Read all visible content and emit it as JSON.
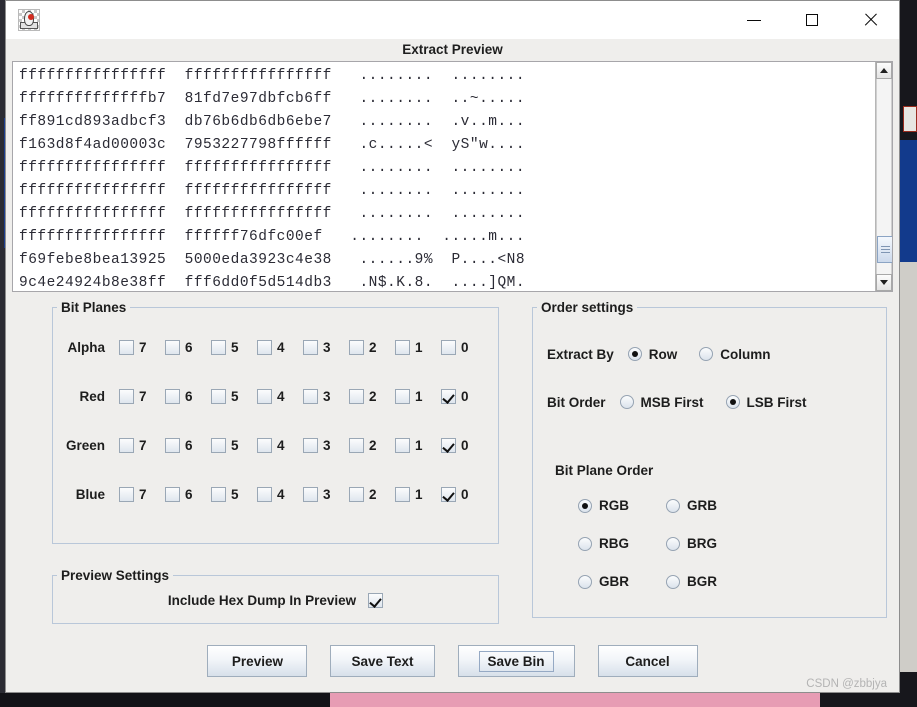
{
  "window": {
    "icon_name": "java-duke-icon",
    "title": "",
    "controls": {
      "minimize": "–",
      "maximize": "□",
      "close": "×"
    }
  },
  "dialog": {
    "heading": "Extract Preview"
  },
  "preview": {
    "hexdump": "ffffffffffffffff  ffffffffffffffff   ........  ........\nffffffffffffffb7  81fd7e97dbfcb6ff   ........  ..~.....\nff891cd893adbcf3  db76b6db6db6ebe7   ........  .v..m...\nf163d8f4ad00003c  7953227798ffffff   .c.....<  yS\"w....\nffffffffffffffff  ffffffffffffffff   ........  ........\nffffffffffffffff  ffffffffffffffff   ........  ........\nffffffffffffffff  ffffffffffffffff   ........  ........\nffffffffffffffff  ffffff76dfc00ef   ........  .....m...\nf69febe8bea13925  5000eda3923c4e38   ......9%  P....<N8\n9c4e24924b8e38ff  fff6dd0f5d514db3   .N$.K.8.  ....]QM.",
    "scrollbar": {
      "name": "vertical-scrollbar",
      "up_arrow": "▲",
      "down_arrow": "▼"
    }
  },
  "bit_planes": {
    "legend": "Bit Planes",
    "bits": [
      "7",
      "6",
      "5",
      "4",
      "3",
      "2",
      "1",
      "0"
    ],
    "rows": [
      {
        "label": "Alpha",
        "checked": [
          false,
          false,
          false,
          false,
          false,
          false,
          false,
          false
        ]
      },
      {
        "label": "Red",
        "checked": [
          false,
          false,
          false,
          false,
          false,
          false,
          false,
          true
        ]
      },
      {
        "label": "Green",
        "checked": [
          false,
          false,
          false,
          false,
          false,
          false,
          false,
          true
        ]
      },
      {
        "label": "Blue",
        "checked": [
          false,
          false,
          false,
          false,
          false,
          false,
          false,
          true
        ]
      }
    ]
  },
  "preview_settings": {
    "legend": "Preview Settings",
    "include_hex_dump_label": "Include Hex Dump In Preview",
    "include_hex_dump_checked": true
  },
  "order_settings": {
    "legend": "Order settings",
    "extract_by": {
      "label": "Extract By",
      "options": [
        "Row",
        "Column"
      ],
      "selected": "Row"
    },
    "bit_order": {
      "label": "Bit Order",
      "options": [
        "MSB First",
        "LSB First"
      ],
      "selected": "LSB First"
    },
    "bit_plane_order": {
      "title": "Bit Plane Order",
      "options": [
        "RGB",
        "GRB",
        "RBG",
        "BRG",
        "GBR",
        "BGR"
      ],
      "selected": "RGB"
    }
  },
  "buttons": [
    {
      "label": "Preview",
      "focused": false
    },
    {
      "label": "Save Text",
      "focused": false
    },
    {
      "label": "Save Bin",
      "focused": true
    },
    {
      "label": "Cancel",
      "focused": false
    }
  ],
  "watermark": "CSDN @zbbjya",
  "colors": {
    "panel_bg": "#efeeec",
    "group_border": "#b9c7d9",
    "preview_bg": "#ffffff",
    "text": "#1d1d1d",
    "hex_text": "#2b2b35",
    "accent_button": "#d7e0ea"
  }
}
